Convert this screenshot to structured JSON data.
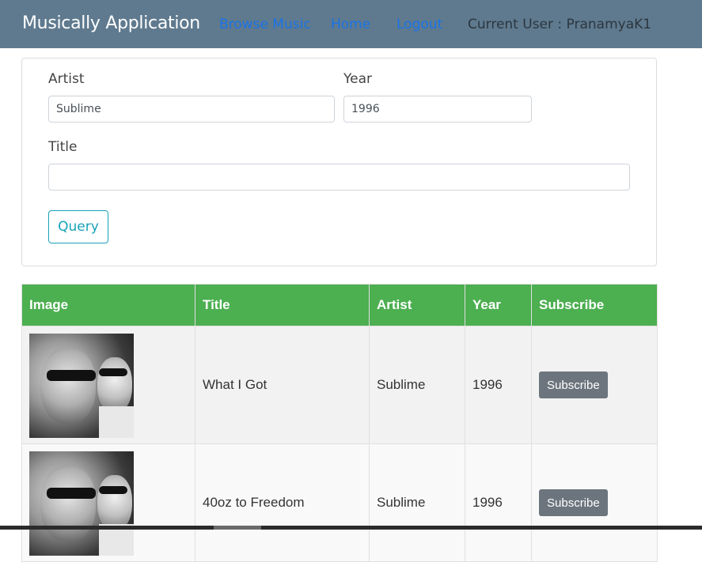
{
  "navbar": {
    "brand": "Musically Application",
    "links": [
      "Browse Music",
      "Home",
      "Logout"
    ],
    "current_user": "Current User : PranamyaK1",
    "link_color": "#1a73e8",
    "background": "#5f7a8e"
  },
  "query_form": {
    "artist_label": "Artist",
    "artist_value": "Sublime",
    "year_label": "Year",
    "year_value": "1996",
    "title_label": "Title",
    "title_value": "",
    "query_button": "Query"
  },
  "table": {
    "header_color": "#4caf50",
    "columns": [
      "Image",
      "Title",
      "Artist",
      "Year",
      "Subscribe"
    ],
    "rows": [
      {
        "image": "sublime-album-cover",
        "title": "What I Got",
        "artist": "Sublime",
        "year": "1996",
        "action": "Subscribe"
      },
      {
        "image": "sublime-album-cover",
        "title": "40oz to Freedom",
        "artist": "Sublime",
        "year": "1996",
        "action": "Subscribe"
      }
    ]
  }
}
